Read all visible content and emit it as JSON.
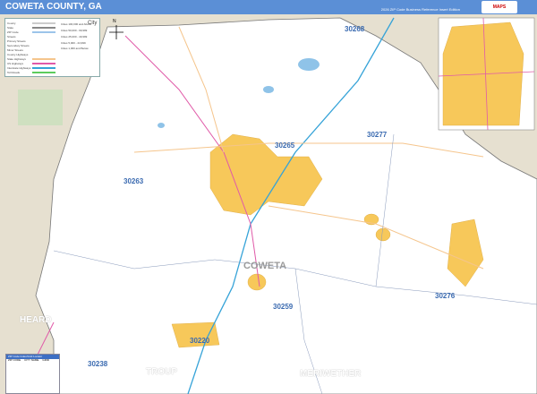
{
  "header": {
    "title": "COWETA COUNTY, GA",
    "edition": "2026 ZIP Code Business Reference Insert Edition",
    "logo": "Market MAPS"
  },
  "colors": {
    "header": "#5b8fd6",
    "land": "#e6e0d0",
    "county": "#ffffff",
    "city": "#f7c85a",
    "water": "#8fc3e8",
    "interstate": "#36a3d8",
    "us_highway": "#e05aa8"
  },
  "legend": {
    "items": [
      "County",
      "State",
      "ZIP Code",
      "Streets",
      "Primary Streets",
      "Secondary Streets",
      "Minor Streets",
      "County Highways",
      "State Highways",
      "US Highways",
      "Interstate Highways",
      "Toll Roads"
    ],
    "population": [
      "Cities 100,000 and Above",
      "Cities 50,000 - 99,999",
      "Cities 25,000 - 49,999",
      "Cities 5,000 - 24,999",
      "Cities 1,000 and Below"
    ],
    "city_sample": "City"
  },
  "zip_labels": [
    "30268",
    "30265",
    "30277",
    "30263",
    "30259",
    "30276",
    "30220",
    "30238"
  ],
  "county_labels": {
    "main": "COWETA",
    "heard": "HEARD",
    "troup": "TROUP",
    "meriwether": "MERIWETHER"
  },
  "zip_index": {
    "title": "ZIP Code Index/Grid Locator",
    "columns": [
      "ZIP CODE",
      "CITY NAME",
      "GRID"
    ]
  },
  "compass": "N"
}
